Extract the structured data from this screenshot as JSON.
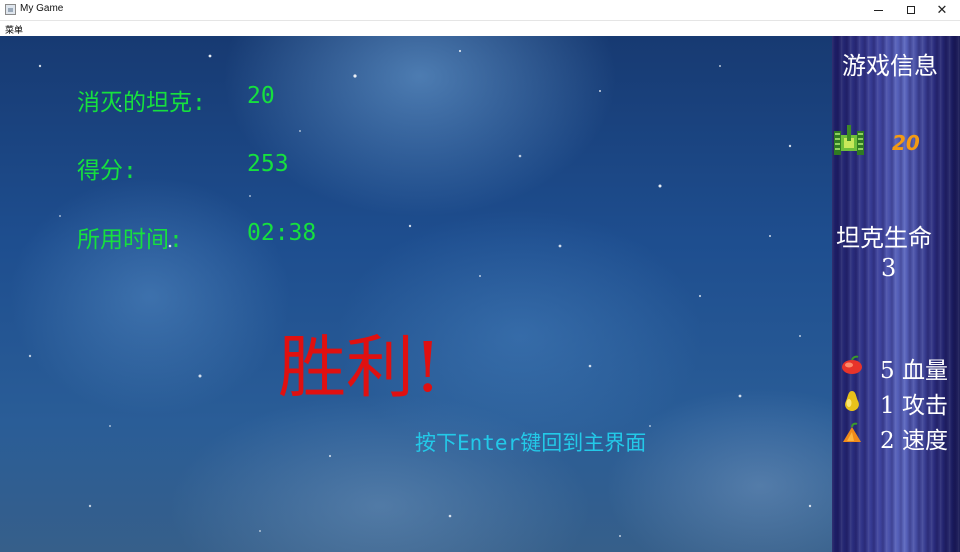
{
  "window": {
    "title": "My Game",
    "menu": [
      "菜单"
    ]
  },
  "stats": {
    "destroyed_label": "消灭的坦克:",
    "destroyed_value": "20",
    "score_label": "得分:",
    "score_value": "253",
    "time_label": "所用时间:",
    "time_value": "02:38"
  },
  "result": {
    "message": "胜利!",
    "hint": "按下Enter键回到主界面"
  },
  "sidebar": {
    "title": "游戏信息",
    "tank_icon": "tank-icon",
    "tank_count": "20",
    "life_label": "坦克生命",
    "life_value": "3",
    "items": [
      {
        "icon": "heart-fruit-icon",
        "count": "5",
        "label": "血量"
      },
      {
        "icon": "pear-icon",
        "count": "1",
        "label": "攻击"
      },
      {
        "icon": "orange-fruit-icon",
        "count": "2",
        "label": "速度"
      }
    ]
  },
  "colors": {
    "stat_text": "#16e03e",
    "victory_text": "#e01010",
    "hint_text": "#23c9e8",
    "tank_count": "#f29a14"
  }
}
